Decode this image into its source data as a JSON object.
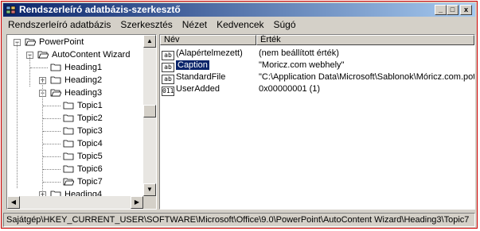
{
  "window": {
    "title": "Rendszerleíró adatbázis-szerkesztő",
    "buttons": [
      "_",
      "□",
      "x"
    ]
  },
  "menu": [
    "Rendszerleíró adatbázis",
    "Szerkesztés",
    "Nézet",
    "Kedvencek",
    "Súgó"
  ],
  "tree": {
    "items": [
      {
        "label": "PowerPoint",
        "expander": "−"
      },
      {
        "label": "AutoContent Wizard",
        "expander": "−"
      },
      {
        "label": "Heading1",
        "expander": ""
      },
      {
        "label": "Heading2",
        "expander": "+"
      },
      {
        "label": "Heading3",
        "expander": "−"
      },
      {
        "label": "Topic1",
        "expander": ""
      },
      {
        "label": "Topic2",
        "expander": ""
      },
      {
        "label": "Topic3",
        "expander": ""
      },
      {
        "label": "Topic4",
        "expander": ""
      },
      {
        "label": "Topic5",
        "expander": ""
      },
      {
        "label": "Topic6",
        "expander": ""
      },
      {
        "label": "Topic7",
        "expander": "",
        "selected": true
      },
      {
        "label": "Heading4",
        "expander": "+"
      }
    ]
  },
  "list": {
    "columns": [
      "Név",
      "Érték"
    ],
    "rows": [
      {
        "icon": "ab",
        "name": "(Alapértelmezett)",
        "value": "(nem beállított érték)"
      },
      {
        "icon": "ab",
        "name": "Caption",
        "value": "\"Moricz.com webhely\"",
        "selected": true
      },
      {
        "icon": "ab",
        "name": "StandardFile",
        "value": "\"C:\\Application Data\\Microsoft\\Sablonok\\Móricz.com.pot\""
      },
      {
        "icon": "011",
        "name": "UserAdded",
        "value": "0x00000001 (1)"
      }
    ]
  },
  "status": "Sajátgép\\HKEY_CURRENT_USER\\SOFTWARE\\Microsoft\\Office\\9.0\\PowerPoint\\AutoContent Wizard\\Heading3\\Topic7",
  "colors": {
    "titlebar_start": "#0a246a",
    "titlebar_end": "#a6caf0",
    "selection": "#0a246a",
    "chrome": "#d4d0c8",
    "window_border": "#d10000"
  }
}
